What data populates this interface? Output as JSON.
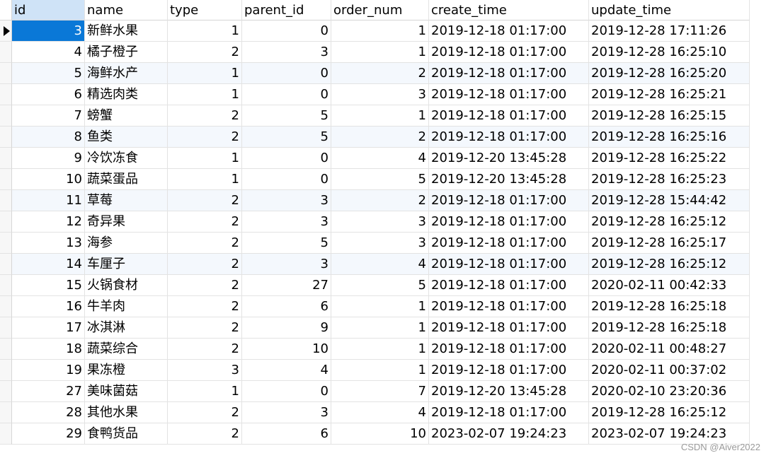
{
  "table": {
    "columns": [
      "id",
      "name",
      "type",
      "parent_id",
      "order_num",
      "create_time",
      "update_time"
    ],
    "rows": [
      {
        "id": "3",
        "name": "新鲜水果",
        "type": "1",
        "parent_id": "0",
        "order_num": "1",
        "create_time": "2019-12-18 01:17:00",
        "update_time": "2019-12-28 17:11:26"
      },
      {
        "id": "4",
        "name": "橘子橙子",
        "type": "2",
        "parent_id": "3",
        "order_num": "1",
        "create_time": "2019-12-18 01:17:00",
        "update_time": "2019-12-28 16:25:10"
      },
      {
        "id": "5",
        "name": "海鲜水产",
        "type": "1",
        "parent_id": "0",
        "order_num": "2",
        "create_time": "2019-12-18 01:17:00",
        "update_time": "2019-12-28 16:25:20"
      },
      {
        "id": "6",
        "name": "精选肉类",
        "type": "1",
        "parent_id": "0",
        "order_num": "3",
        "create_time": "2019-12-18 01:17:00",
        "update_time": "2019-12-28 16:25:21"
      },
      {
        "id": "7",
        "name": "螃蟹",
        "type": "2",
        "parent_id": "5",
        "order_num": "1",
        "create_time": "2019-12-18 01:17:00",
        "update_time": "2019-12-28 16:25:15"
      },
      {
        "id": "8",
        "name": "鱼类",
        "type": "2",
        "parent_id": "5",
        "order_num": "2",
        "create_time": "2019-12-18 01:17:00",
        "update_time": "2019-12-28 16:25:16"
      },
      {
        "id": "9",
        "name": "冷饮冻食",
        "type": "1",
        "parent_id": "0",
        "order_num": "4",
        "create_time": "2019-12-20 13:45:28",
        "update_time": "2019-12-28 16:25:22"
      },
      {
        "id": "10",
        "name": "蔬菜蛋品",
        "type": "1",
        "parent_id": "0",
        "order_num": "5",
        "create_time": "2019-12-20 13:45:28",
        "update_time": "2019-12-28 16:25:23"
      },
      {
        "id": "11",
        "name": "草莓",
        "type": "2",
        "parent_id": "3",
        "order_num": "2",
        "create_time": "2019-12-18 01:17:00",
        "update_time": "2019-12-28 15:44:42"
      },
      {
        "id": "12",
        "name": "奇异果",
        "type": "2",
        "parent_id": "3",
        "order_num": "3",
        "create_time": "2019-12-18 01:17:00",
        "update_time": "2019-12-28 16:25:12"
      },
      {
        "id": "13",
        "name": "海参",
        "type": "2",
        "parent_id": "5",
        "order_num": "3",
        "create_time": "2019-12-18 01:17:00",
        "update_time": "2019-12-28 16:25:17"
      },
      {
        "id": "14",
        "name": "车厘子",
        "type": "2",
        "parent_id": "3",
        "order_num": "4",
        "create_time": "2019-12-18 01:17:00",
        "update_time": "2019-12-28 16:25:12"
      },
      {
        "id": "15",
        "name": "火锅食材",
        "type": "2",
        "parent_id": "27",
        "order_num": "5",
        "create_time": "2019-12-18 01:17:00",
        "update_time": "2020-02-11 00:42:33"
      },
      {
        "id": "16",
        "name": "牛羊肉",
        "type": "2",
        "parent_id": "6",
        "order_num": "1",
        "create_time": "2019-12-18 01:17:00",
        "update_time": "2019-12-28 16:25:18"
      },
      {
        "id": "17",
        "name": "冰淇淋",
        "type": "2",
        "parent_id": "9",
        "order_num": "1",
        "create_time": "2019-12-18 01:17:00",
        "update_time": "2019-12-28 16:25:18"
      },
      {
        "id": "18",
        "name": "蔬菜综合",
        "type": "2",
        "parent_id": "10",
        "order_num": "1",
        "create_time": "2019-12-18 01:17:00",
        "update_time": "2020-02-11 00:48:27"
      },
      {
        "id": "19",
        "name": "果冻橙",
        "type": "3",
        "parent_id": "4",
        "order_num": "1",
        "create_time": "2019-12-18 01:17:00",
        "update_time": "2020-02-11 00:37:02"
      },
      {
        "id": "27",
        "name": "美味菌菇",
        "type": "1",
        "parent_id": "0",
        "order_num": "7",
        "create_time": "2019-12-20 13:45:28",
        "update_time": "2020-02-10 23:20:36"
      },
      {
        "id": "28",
        "name": "其他水果",
        "type": "2",
        "parent_id": "3",
        "order_num": "4",
        "create_time": "2019-12-18 01:17:00",
        "update_time": "2019-12-28 16:25:12"
      },
      {
        "id": "29",
        "name": "食鸭货品",
        "type": "2",
        "parent_id": "6",
        "order_num": "10",
        "create_time": "2023-02-07 19:24:23",
        "update_time": "2023-02-07 19:24:23"
      }
    ],
    "selected_row": 0,
    "alt_rows": [
      2,
      5,
      8,
      11
    ]
  },
  "icons": {
    "row_indicator": "current-row-arrow-icon"
  },
  "colors": {
    "selection": "#0a78d7",
    "selected_text": "#ffffff",
    "header_id_bg": "#cfe3f7",
    "alt_row": "#f4f8fd",
    "grid_line": "#e3e3e3"
  },
  "watermark": "CSDN @Aiver2022"
}
